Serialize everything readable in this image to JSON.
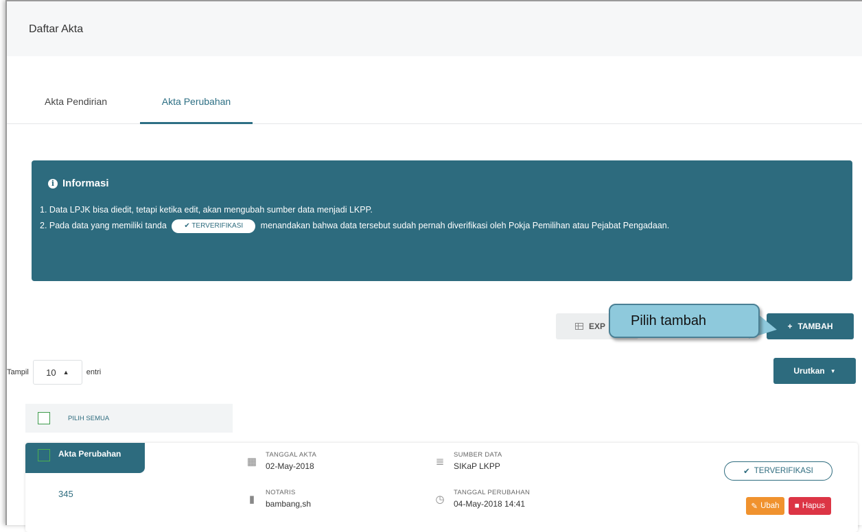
{
  "header": {
    "title": "Daftar Akta"
  },
  "tabs": [
    {
      "label": "Akta Pendirian",
      "active": false
    },
    {
      "label": "Akta Perubahan",
      "active": true
    }
  ],
  "info": {
    "title": "Informasi",
    "line1": "1. Data LPJK bisa diedit, tetapi ketika edit, akan mengubah sumber data menjadi LKPP.",
    "line2_pre": "2. Pada data yang memiliki tanda",
    "badge": "TERVERIFIKASI",
    "line2_post": "menandakan bahwa data tersebut sudah pernah diverifikasi oleh Pokja Pemilihan atau Pejabat Pengadaan."
  },
  "toolbar": {
    "export_label": "EXP",
    "tambah_label": "TAMBAH",
    "urutkan_label": "Urutkan"
  },
  "callout": {
    "text": "Pilih tambah"
  },
  "pagination": {
    "show_label": "Tampil",
    "page_size": "10",
    "entries_label": "entri"
  },
  "select_all_label": "PILIH SEMUA",
  "record": {
    "type": "Akta Perubahan",
    "number": "345",
    "tanggal_akta_label": "TANGGAL AKTA",
    "tanggal_akta": "02-May-2018",
    "notaris_label": "NOTARIS",
    "notaris": "bambang,sh",
    "sumber_data_label": "SUMBER DATA",
    "sumber_data": "SIKaP LKPP",
    "tanggal_perubahan_label": "TANGGAL PERUBAHAN",
    "tanggal_perubahan": "04-May-2018 14:41",
    "status": "TERVERIFIKASI",
    "ubah_label": "Ubah",
    "hapus_label": "Hapus"
  },
  "colors": {
    "primary": "#2d6b7e",
    "warning": "#f0922e",
    "danger": "#dc3545",
    "callout": "#8ec9dc"
  }
}
